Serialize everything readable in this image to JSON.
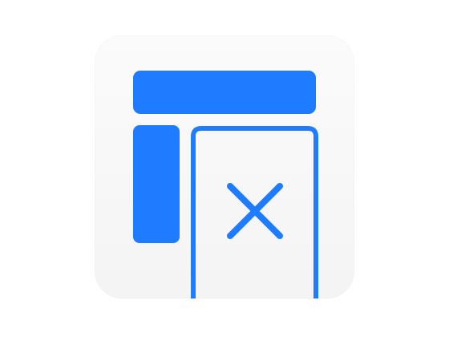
{
  "app_icon": {
    "name": "layout-dismiss-panel",
    "accent_color": "#1f7bff",
    "tile_color": "#f6f6f6"
  }
}
